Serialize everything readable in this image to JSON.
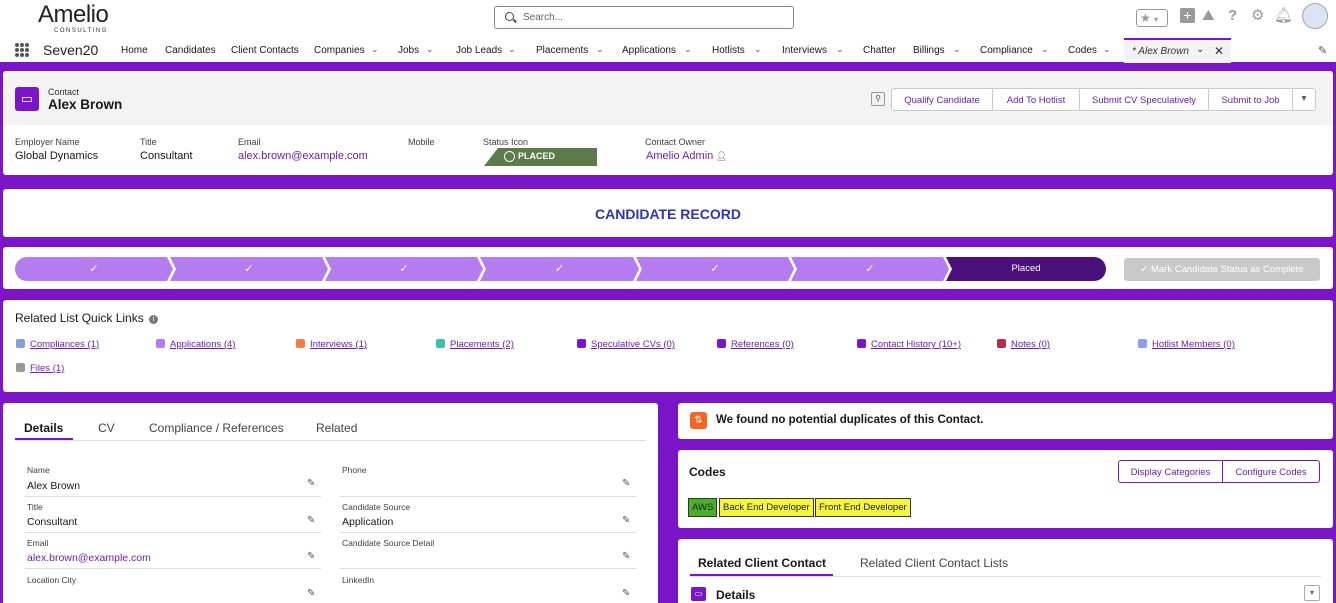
{
  "brand": {
    "name": "Amelio",
    "sub": "CONSULTING"
  },
  "search": {
    "placeholder": "Search..."
  },
  "nav": {
    "app": "Seven20",
    "items": [
      "Home",
      "Candidates",
      "Client Contacts",
      "Companies",
      "Jobs",
      "Job Leads",
      "Placements",
      "Applications",
      "Hotlists",
      "Interviews",
      "Chatter",
      "Billings",
      "Compliance",
      "Codes"
    ],
    "active_tab": "* Alex Brown"
  },
  "record": {
    "type": "Contact",
    "name": "Alex Brown",
    "actions": [
      "Qualify Candidate",
      "Add To Hotlist",
      "Submit CV Speculatively",
      "Submit to Job"
    ],
    "fields": [
      {
        "label": "Employer Name",
        "value": "Global Dynamics"
      },
      {
        "label": "Title",
        "value": "Consultant"
      },
      {
        "label": "Email",
        "value": "alex.brown@example.com"
      },
      {
        "label": "Mobile",
        "value": ""
      },
      {
        "label": "Status Icon",
        "value": "PLACED"
      },
      {
        "label": "Contact Owner",
        "value": "Amelio Admin"
      }
    ]
  },
  "banner": {
    "title": "CANDIDATE RECORD"
  },
  "path": {
    "steps": [
      "",
      "",
      "",
      "",
      "",
      "",
      ""
    ],
    "current": "Placed",
    "complete_button": "Mark Candidate Status as Complete"
  },
  "quicklinks": {
    "title": "Related List Quick Links",
    "items": [
      {
        "label": "Compliances (1)",
        "color": "#8a9bd8"
      },
      {
        "label": "Applications (4)",
        "color": "#b57cef"
      },
      {
        "label": "Interviews (1)",
        "color": "#ef7e4b"
      },
      {
        "label": "Placements (2)",
        "color": "#3fbfa5"
      },
      {
        "label": "Speculative CVs (0)",
        "color": "#7a16c8"
      },
      {
        "label": "References (0)",
        "color": "#7a16c8"
      },
      {
        "label": "Contact History (10+)",
        "color": "#7a16c8"
      },
      {
        "label": "Notes (0)",
        "color": "#b02e4a"
      },
      {
        "label": "Hotlist Members (0)",
        "color": "#8aa0ef"
      },
      {
        "label": "Files (1)",
        "color": "#999999"
      }
    ]
  },
  "details": {
    "tabs": [
      "Details",
      "CV",
      "Compliance / References",
      "Related"
    ],
    "left": [
      {
        "label": "Name",
        "value": "Alex Brown"
      },
      {
        "label": "Title",
        "value": "Consultant"
      },
      {
        "label": "Email",
        "value": "alex.brown@example.com"
      },
      {
        "label": "Location City",
        "value": ""
      }
    ],
    "right": [
      {
        "label": "Phone",
        "value": ""
      },
      {
        "label": "Candidate Source",
        "value": "Application"
      },
      {
        "label": "Candidate Source Detail",
        "value": ""
      },
      {
        "label": "LinkedIn",
        "value": ""
      }
    ]
  },
  "duplicates": {
    "text": "We found no potential duplicates of this Contact."
  },
  "codes": {
    "title": "Codes",
    "buttons": [
      "Display Categories",
      "Configure Codes"
    ],
    "chips": [
      {
        "label": "AWS",
        "color": "#4caf2a"
      },
      {
        "label": "Back End Developer",
        "color": "#f5f53a"
      },
      {
        "label": "Front End Developer",
        "color": "#f5f53a"
      }
    ]
  },
  "related": {
    "tabs": [
      "Related Client Contact",
      "Related Client Contact Lists"
    ],
    "section": "Details"
  }
}
